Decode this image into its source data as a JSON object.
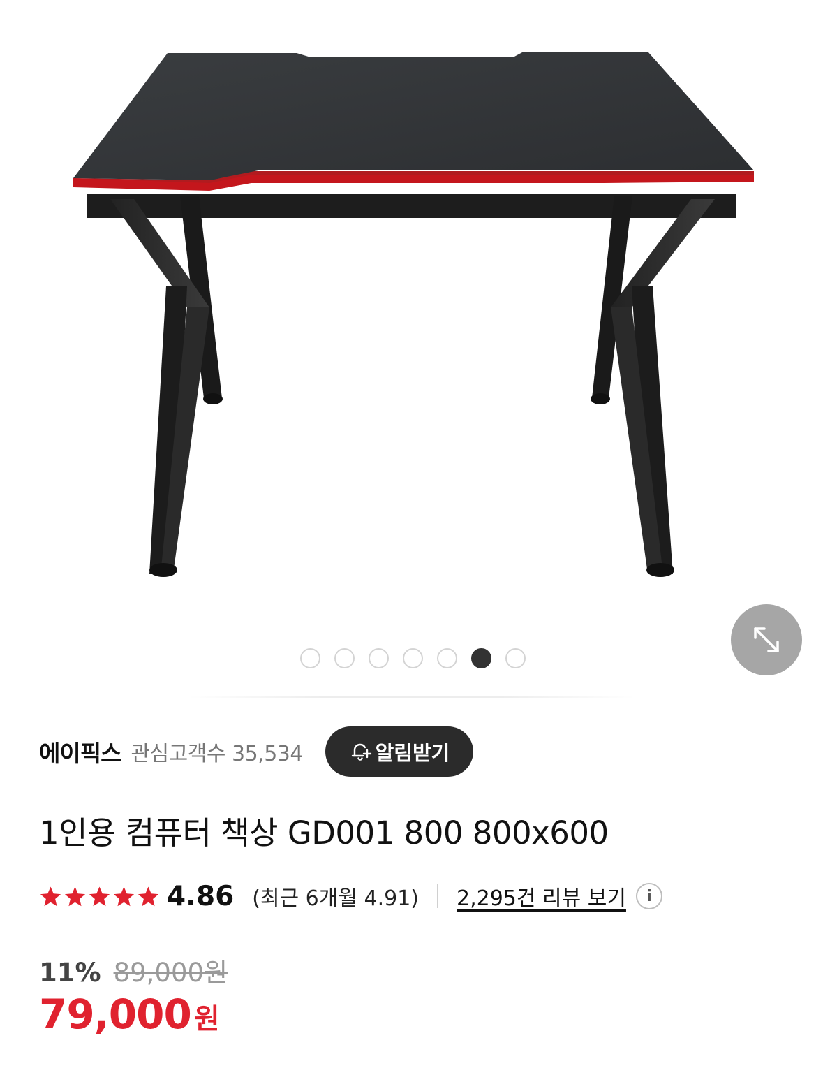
{
  "gallery": {
    "image_icon": "gaming-desk-photo",
    "total_slides": 7,
    "active_slide": 6,
    "expand_icon": "expand-arrows-icon"
  },
  "seller": {
    "name": "에이픽스",
    "followers_label": "관심고객수 35,534",
    "notify_label": "알림받기",
    "notify_icon": "bell-plus-icon"
  },
  "product": {
    "title": "1인용 컴퓨터 책상 GD001 800 800x600"
  },
  "rating": {
    "stars": 5,
    "score": "4.86",
    "recent": "(최근 6개월 4.91)",
    "review_link": "2,295건 리뷰 보기",
    "info_icon": "i",
    "star_color": "#e0222f"
  },
  "price": {
    "discount_rate": "11%",
    "original": "89,000원",
    "sale_value": "79,000",
    "sale_unit": "원",
    "accent_color": "#e0222f"
  }
}
